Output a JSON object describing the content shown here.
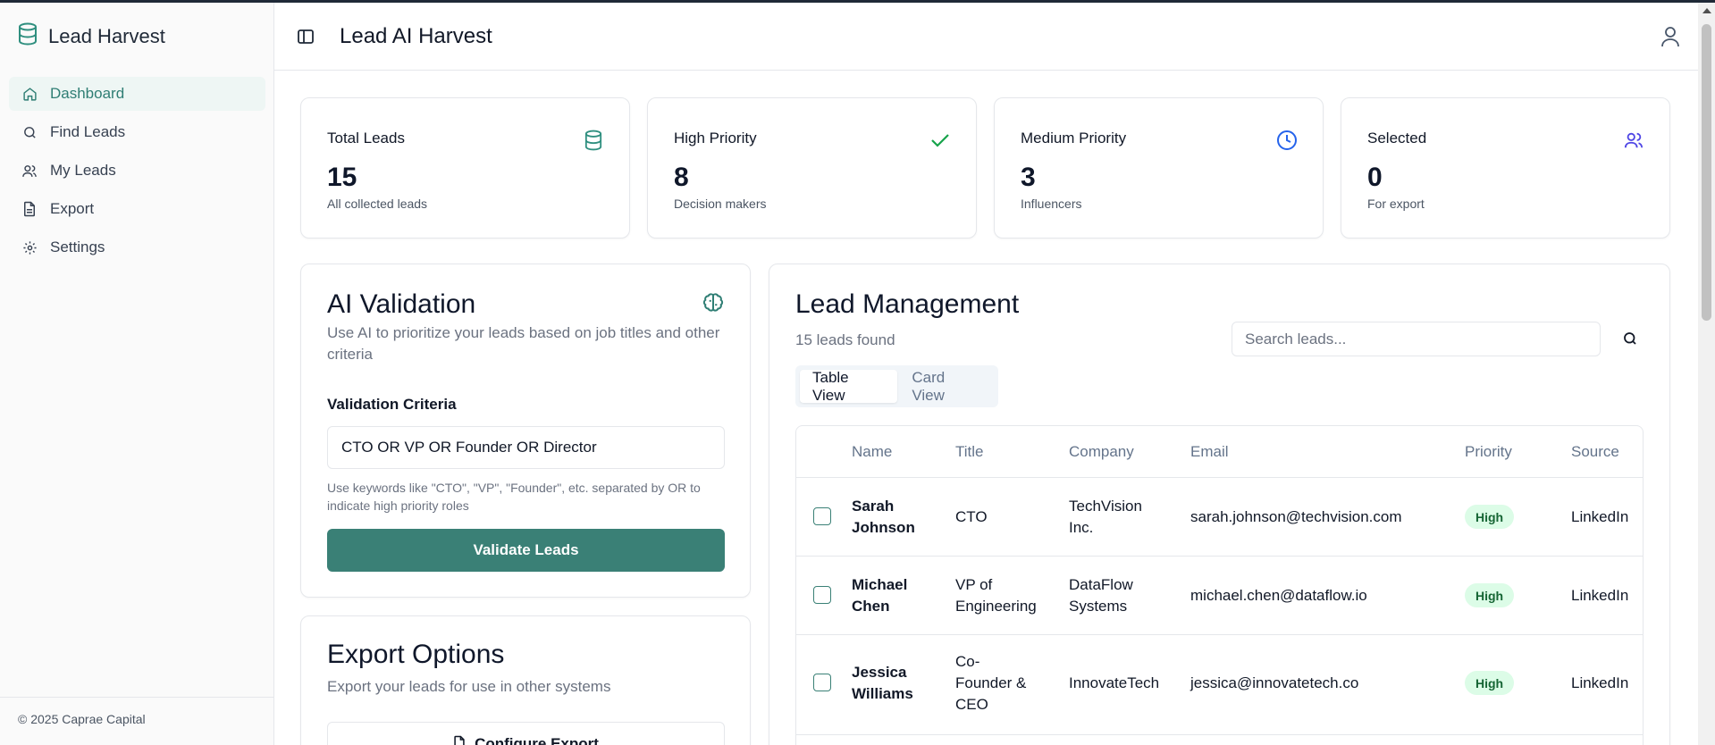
{
  "app": {
    "name": "Lead Harvest",
    "page_title": "Lead AI Harvest",
    "footer": "© 2025 Caprae Capital"
  },
  "sidebar": {
    "items": [
      {
        "label": "Dashboard",
        "icon": "home-icon",
        "active": true
      },
      {
        "label": "Find Leads",
        "icon": "search-icon",
        "active": false
      },
      {
        "label": "My Leads",
        "icon": "users-icon",
        "active": false
      },
      {
        "label": "Export",
        "icon": "file-icon",
        "active": false
      },
      {
        "label": "Settings",
        "icon": "gear-icon",
        "active": false
      }
    ]
  },
  "stats": [
    {
      "label": "Total Leads",
      "value": "15",
      "sub": "All collected leads",
      "icon": "database-icon",
      "color": "#2f8f7f"
    },
    {
      "label": "High Priority",
      "value": "8",
      "sub": "Decision makers",
      "icon": "check-icon",
      "color": "#16a34a"
    },
    {
      "label": "Medium Priority",
      "value": "3",
      "sub": "Influencers",
      "icon": "clock-icon",
      "color": "#2563eb"
    },
    {
      "label": "Selected",
      "value": "0",
      "sub": "For export",
      "icon": "users-icon",
      "color": "#4f46e5"
    }
  ],
  "ai_validation": {
    "title": "AI Validation",
    "description": "Use AI to prioritize your leads based on job titles and other criteria",
    "criteria_label": "Validation Criteria",
    "criteria_value": "CTO OR VP OR Founder OR Director",
    "hint": "Use keywords like \"CTO\", \"VP\", \"Founder\", etc. separated by OR to indicate high priority roles",
    "button": "Validate Leads"
  },
  "export_options": {
    "title": "Export Options",
    "description": "Export your leads for use in other systems",
    "button": "Configure Export"
  },
  "lead_management": {
    "title": "Lead Management",
    "count_text": "15 leads found",
    "search_placeholder": "Search leads...",
    "tabs": [
      "Table View",
      "Card View"
    ],
    "columns": [
      "Name",
      "Title",
      "Company",
      "Email",
      "Priority",
      "Source"
    ],
    "rows": [
      {
        "name": [
          "Sarah",
          "Johnson"
        ],
        "title": [
          "CTO"
        ],
        "company": [
          "TechVision",
          "Inc."
        ],
        "email": "sarah.johnson@techvision.com",
        "priority": "High",
        "source": "LinkedIn"
      },
      {
        "name": [
          "Michael",
          "Chen"
        ],
        "title": [
          "VP of",
          "Engineering"
        ],
        "company": [
          "DataFlow",
          "Systems"
        ],
        "email": "michael.chen@dataflow.io",
        "priority": "High",
        "source": "LinkedIn"
      },
      {
        "name": [
          "Jessica",
          "Williams"
        ],
        "title": [
          "Co-",
          "Founder &",
          "CEO"
        ],
        "company": [
          "InnovateTech"
        ],
        "email": "jessica@innovatetech.co",
        "priority": "High",
        "source": "LinkedIn"
      }
    ]
  },
  "colors": {
    "accent": "#3a8076",
    "active_nav_bg": "#eef6f4",
    "badge_bg": "#dcfce7",
    "badge_text": "#166534"
  }
}
